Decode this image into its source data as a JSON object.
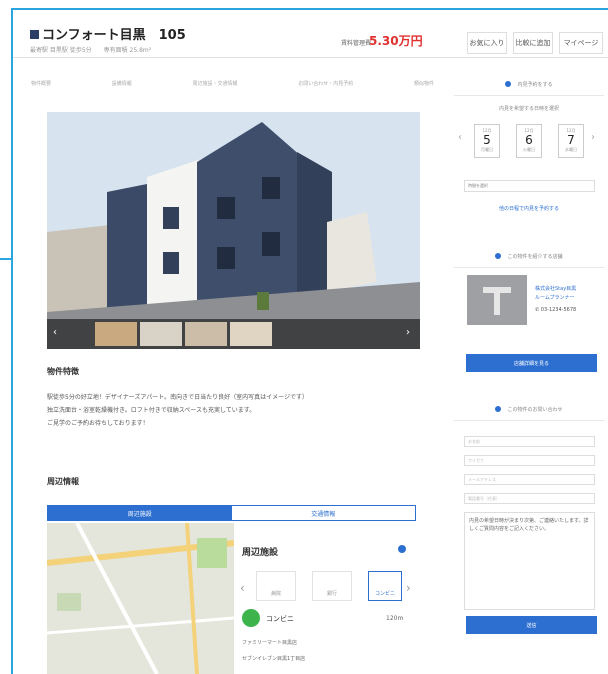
{
  "header": {
    "title": "コンフォート目黒　105",
    "subtitle": "最寄駅 目黒駅 徒歩5分　　専有面積 25.8m²",
    "price_label": "賃料管理費",
    "price": "5.30万円",
    "buttons": [
      "お気に入り",
      "比較に追加",
      "マイページ"
    ]
  },
  "tabs": [
    "物件概要",
    "設備情報",
    "周辺施設・交通情報",
    "お問い合わせ・内見予約",
    "類似物件"
  ],
  "features": {
    "title": "物件特徴",
    "lines": [
      "駅徒歩5分の好立地！デザイナーズアパート。南向きで日当たり良好（室内写真はイメージです）",
      "独立洗面台・浴室乾燥機付き。ロフト付きで収納スペースも充実しています。",
      "ご見学のご予約お待ちしております！"
    ]
  },
  "nearby": {
    "title": "周辺情報",
    "tabs": [
      "周辺施設",
      "交通情報"
    ],
    "panel_title": "周辺施設",
    "categories": [
      "病院",
      "銀行",
      "コンビニ"
    ],
    "current_category": "コンビニ",
    "current_distance": "120m",
    "items": [
      "ファミリーマート目黒店",
      "セブンイレブン目黒1丁目店"
    ]
  },
  "schedule": {
    "header": "内見予約をする",
    "subheader": "内見を希望する日時を選択",
    "days": [
      {
        "month": "12月",
        "date": "5",
        "weekday": "月曜日"
      },
      {
        "month": "12月",
        "date": "6",
        "weekday": "火曜日"
      },
      {
        "month": "12月",
        "date": "7",
        "weekday": "水曜日"
      }
    ],
    "time_select": "時間を選択",
    "link": "他の日程で内見を予約する"
  },
  "agent": {
    "header": "この物件を紹介する店舗",
    "name": "株式会社Stay目黒 ",
    "name2": "ルームプランナー",
    "phone": "03-1234-5678",
    "button": "店舗詳細を見る"
  },
  "inquiry": {
    "header": "この物件のお問い合わせ",
    "fields": [
      "お名前",
      "フリガナ",
      "メールアドレス",
      "電話番号（任意）"
    ],
    "message": "内見の希望日時が決まり次第、ご連絡いたします。詳しくご質問内容をご記入ください。",
    "submit": "送信"
  },
  "colors": {
    "accent": "#2d6fd1",
    "price": "#e03131",
    "frame": "#2aa5df"
  }
}
